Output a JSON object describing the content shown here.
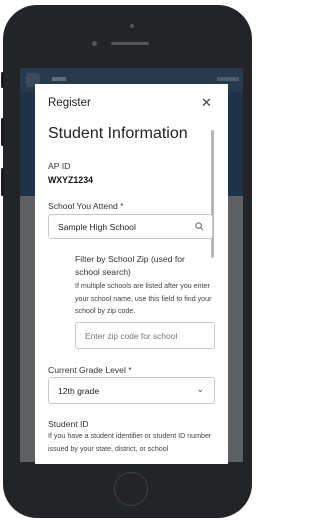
{
  "modal": {
    "header": "Register",
    "close_icon": "close-icon",
    "title": "Student Information",
    "ap_id_label": "AP ID",
    "ap_id_value": "WXYZ1234",
    "school_label": "School You Attend *",
    "school_value": "Sample High School",
    "search_icon": "search-icon",
    "filter_label": "Filter by School Zip (used for school search)",
    "filter_help": "If multiple schools are listed after you enter your school name, use this field to find your school by zip code.",
    "zip_placeholder": "Enter zip code for school",
    "grade_label": "Current Grade Level *",
    "grade_value": "12th grade",
    "chevron_icon": "chevron-down-icon",
    "student_id_label": "Student ID",
    "student_id_help": "If you have a student identifier or student ID number issued by your state, district, or school"
  },
  "colors": {
    "phone": "#232427",
    "backdrop": "#5f6063",
    "page_band": "#1e3146"
  }
}
